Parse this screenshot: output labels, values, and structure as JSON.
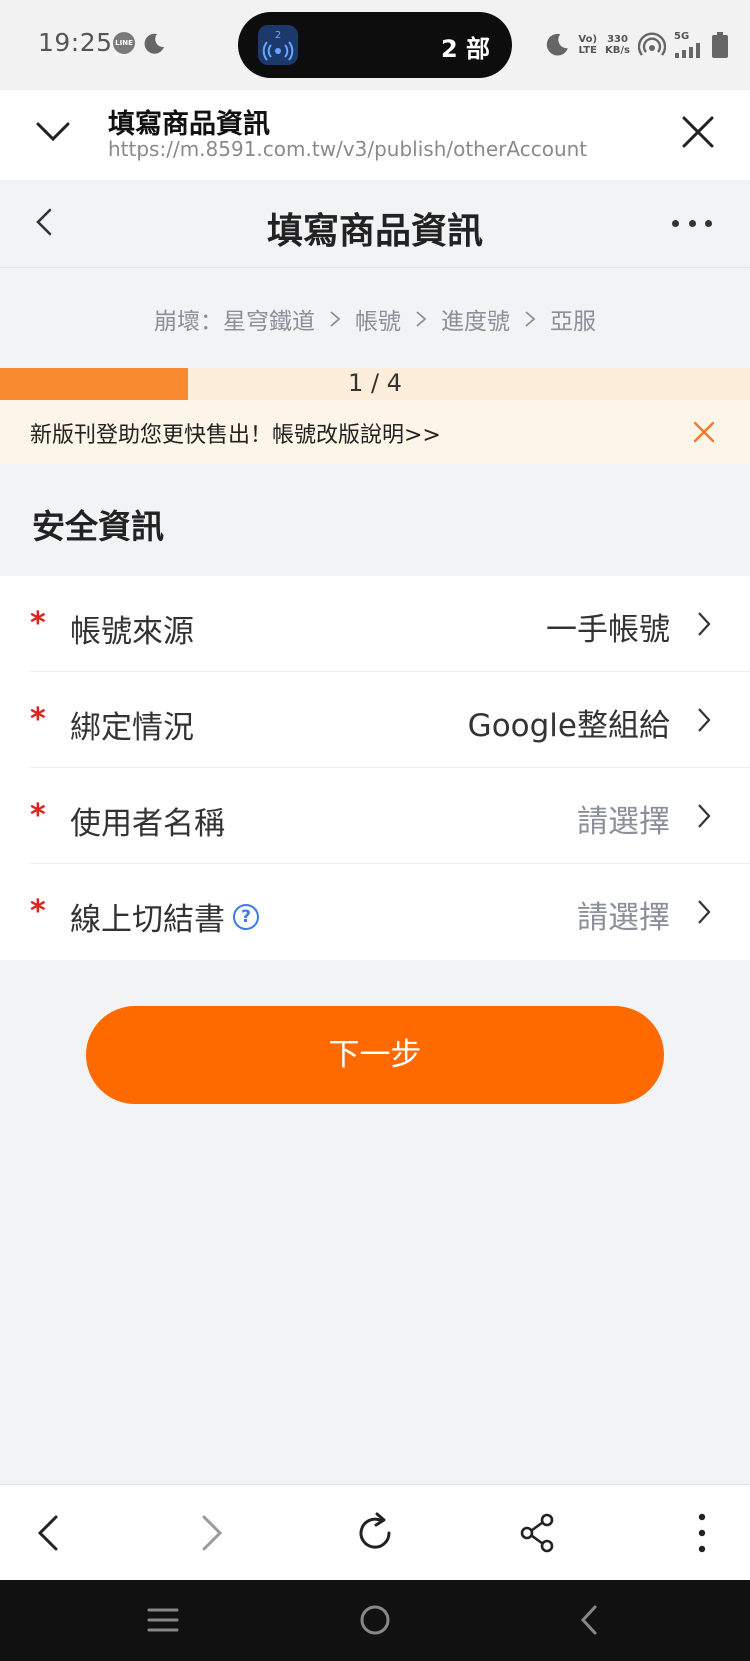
{
  "status_bar": {
    "time": "19:25",
    "line_badge": "LINE",
    "island_badge": "2",
    "island_text": "2 部",
    "volte": [
      "Vo)",
      "LTE"
    ],
    "net_speed": [
      "330",
      "KB/s"
    ],
    "network": "5G"
  },
  "browser": {
    "tab_title": "填寫商品資訊",
    "url": "https://m.8591.com.tw/v3/publish/otherAccount"
  },
  "header": {
    "title": "填寫商品資訊"
  },
  "breadcrumb": [
    "崩壞：星穹鐵道",
    "帳號",
    "進度號",
    "亞服"
  ],
  "progress": {
    "label": "1 / 4",
    "fraction": 0.25
  },
  "notice": {
    "text": "新版刊登助您更快售出！帳號改版說明>>"
  },
  "section": {
    "title": "安全資訊"
  },
  "form": {
    "rows": [
      {
        "label": "帳號來源",
        "value": "一手帳號",
        "placeholder": false
      },
      {
        "label": "綁定情況",
        "value": "Google整組給",
        "placeholder": false
      },
      {
        "label": "使用者名稱",
        "value": "請選擇",
        "placeholder": true
      },
      {
        "label": "線上切結書",
        "value": "請選擇",
        "placeholder": true,
        "help": "?"
      }
    ],
    "required_mark": "*"
  },
  "actions": {
    "next": "下一步"
  },
  "colors": {
    "accent": "#ff6a00",
    "progress": "#f98a30",
    "required": "#e0201b",
    "help": "#3b7be8"
  }
}
